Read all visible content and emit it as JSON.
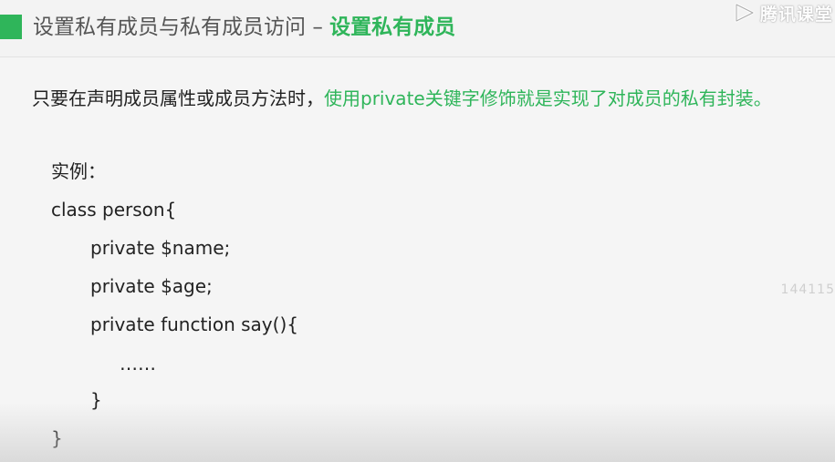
{
  "header": {
    "title_prefix": "设置私有成员与私有成员访问",
    "title_dash": "–",
    "title_highlight": "设置私有成员"
  },
  "watermark": {
    "text": "腾讯课堂",
    "icon": "play-logo-icon"
  },
  "intro": {
    "plain": "只要在声明成员属性或成员方法时，",
    "highlight": "使用private关键字修饰就是实现了对成员的私有封装。"
  },
  "example": {
    "label": "实例：",
    "lines": [
      "class person{",
      "private $name;",
      "private $age;",
      "private function say(){",
      "……",
      "}",
      "}"
    ]
  },
  "side_number": "144115",
  "colors": {
    "accent": "#2fb55a",
    "text": "#222222",
    "background": "#f5f5f5"
  }
}
